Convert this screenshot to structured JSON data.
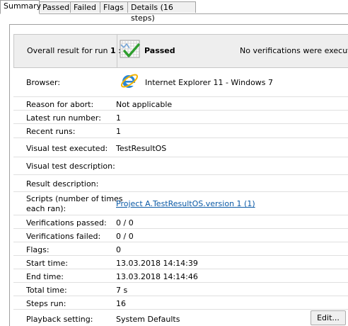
{
  "tabs": [
    "Summary",
    "Passed",
    "Failed",
    "Flags",
    "Details (16 steps)"
  ],
  "header": {
    "overall_prefix": "Overall result for run ",
    "run_number": "1",
    "overall_suffix": " :",
    "status": "Passed",
    "note": "No verifications were executed"
  },
  "rows": {
    "browser": {
      "label": "Browser:",
      "value": "Internet Explorer 11 - Windows 7"
    },
    "reason": {
      "label": "Reason for abort:",
      "value": "Not applicable"
    },
    "latest_run": {
      "label": "Latest run number:",
      "value": "1"
    },
    "recent_runs": {
      "label": "Recent runs:",
      "value": "1"
    },
    "visual_test": {
      "label": "Visual test executed:",
      "value": "TestResultOS"
    },
    "visual_desc": {
      "label": "Visual test description:",
      "value": ""
    },
    "result_desc": {
      "label": "Result description:",
      "value": ""
    },
    "scripts": {
      "label_line1": "Scripts (number of times",
      "label_line2": "each ran):",
      "value": "Project A.TestResultOS.version 1 (1)"
    },
    "ver_passed": {
      "label": "Verifications passed:",
      "value": "0 / 0"
    },
    "ver_failed": {
      "label": "Verifications failed:",
      "value": "0 / 0"
    },
    "flags": {
      "label": "Flags:",
      "value": "0"
    },
    "start": {
      "label": "Start time:",
      "value": "13.03.2018 14:14:39"
    },
    "end": {
      "label": "End time:",
      "value": "13.03.2018 14:14:46"
    },
    "total": {
      "label": "Total time:",
      "value": "7 s"
    },
    "steps": {
      "label": "Steps run:",
      "value": "16"
    },
    "playback": {
      "label": "Playback setting:",
      "value": "System Defaults"
    }
  },
  "edit_button": "Edit...",
  "icons": {
    "status": "passed-chart-check-icon",
    "browser": "internet-explorer-icon"
  },
  "colors": {
    "link": "#0b5aa6",
    "header_bg": "#eeeeee",
    "check_green": "#2e9e2e"
  }
}
